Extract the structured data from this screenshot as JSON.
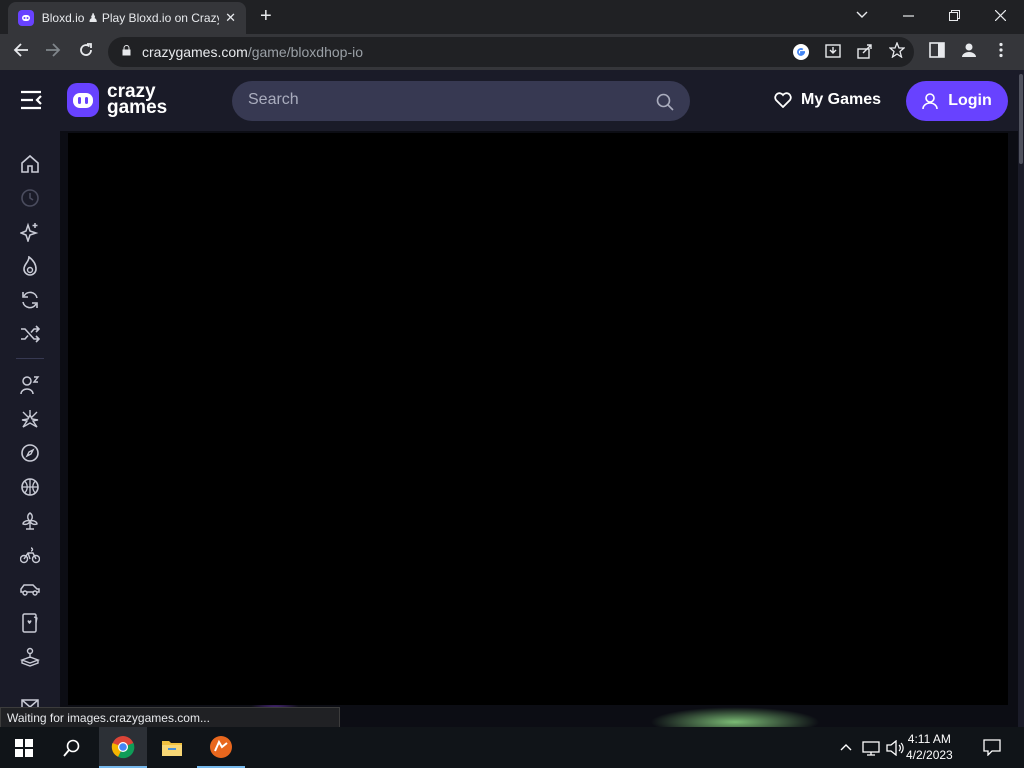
{
  "browser": {
    "tab_title": "Bloxd.io ♟ Play Bloxd.io on CrazyGames",
    "tab_close": "✕",
    "new_tab": "+",
    "url_host": "crazygames.com",
    "url_path": "/game/bloxdhop-io",
    "status_text": "Waiting for images.crazygames.com..."
  },
  "site": {
    "logo_line1": "crazy",
    "logo_line2": "games",
    "search_placeholder": "Search",
    "my_games_label": "My Games",
    "login_label": "Login",
    "brand_color": "#6842ff"
  },
  "sidebar": {
    "items": [
      "home-icon",
      "recent-icon",
      "new-icon",
      "trending-icon",
      "updated-icon",
      "random-icon",
      "multiplayer-icon",
      "action-icon",
      "adventure-icon",
      "basketball-icon",
      "casual-icon",
      "bike-icon",
      "car-icon",
      "card-icon",
      "controller-icon",
      "mail-icon"
    ]
  },
  "taskbar": {
    "time": "4:11 AM",
    "date": "4/2/2023"
  }
}
